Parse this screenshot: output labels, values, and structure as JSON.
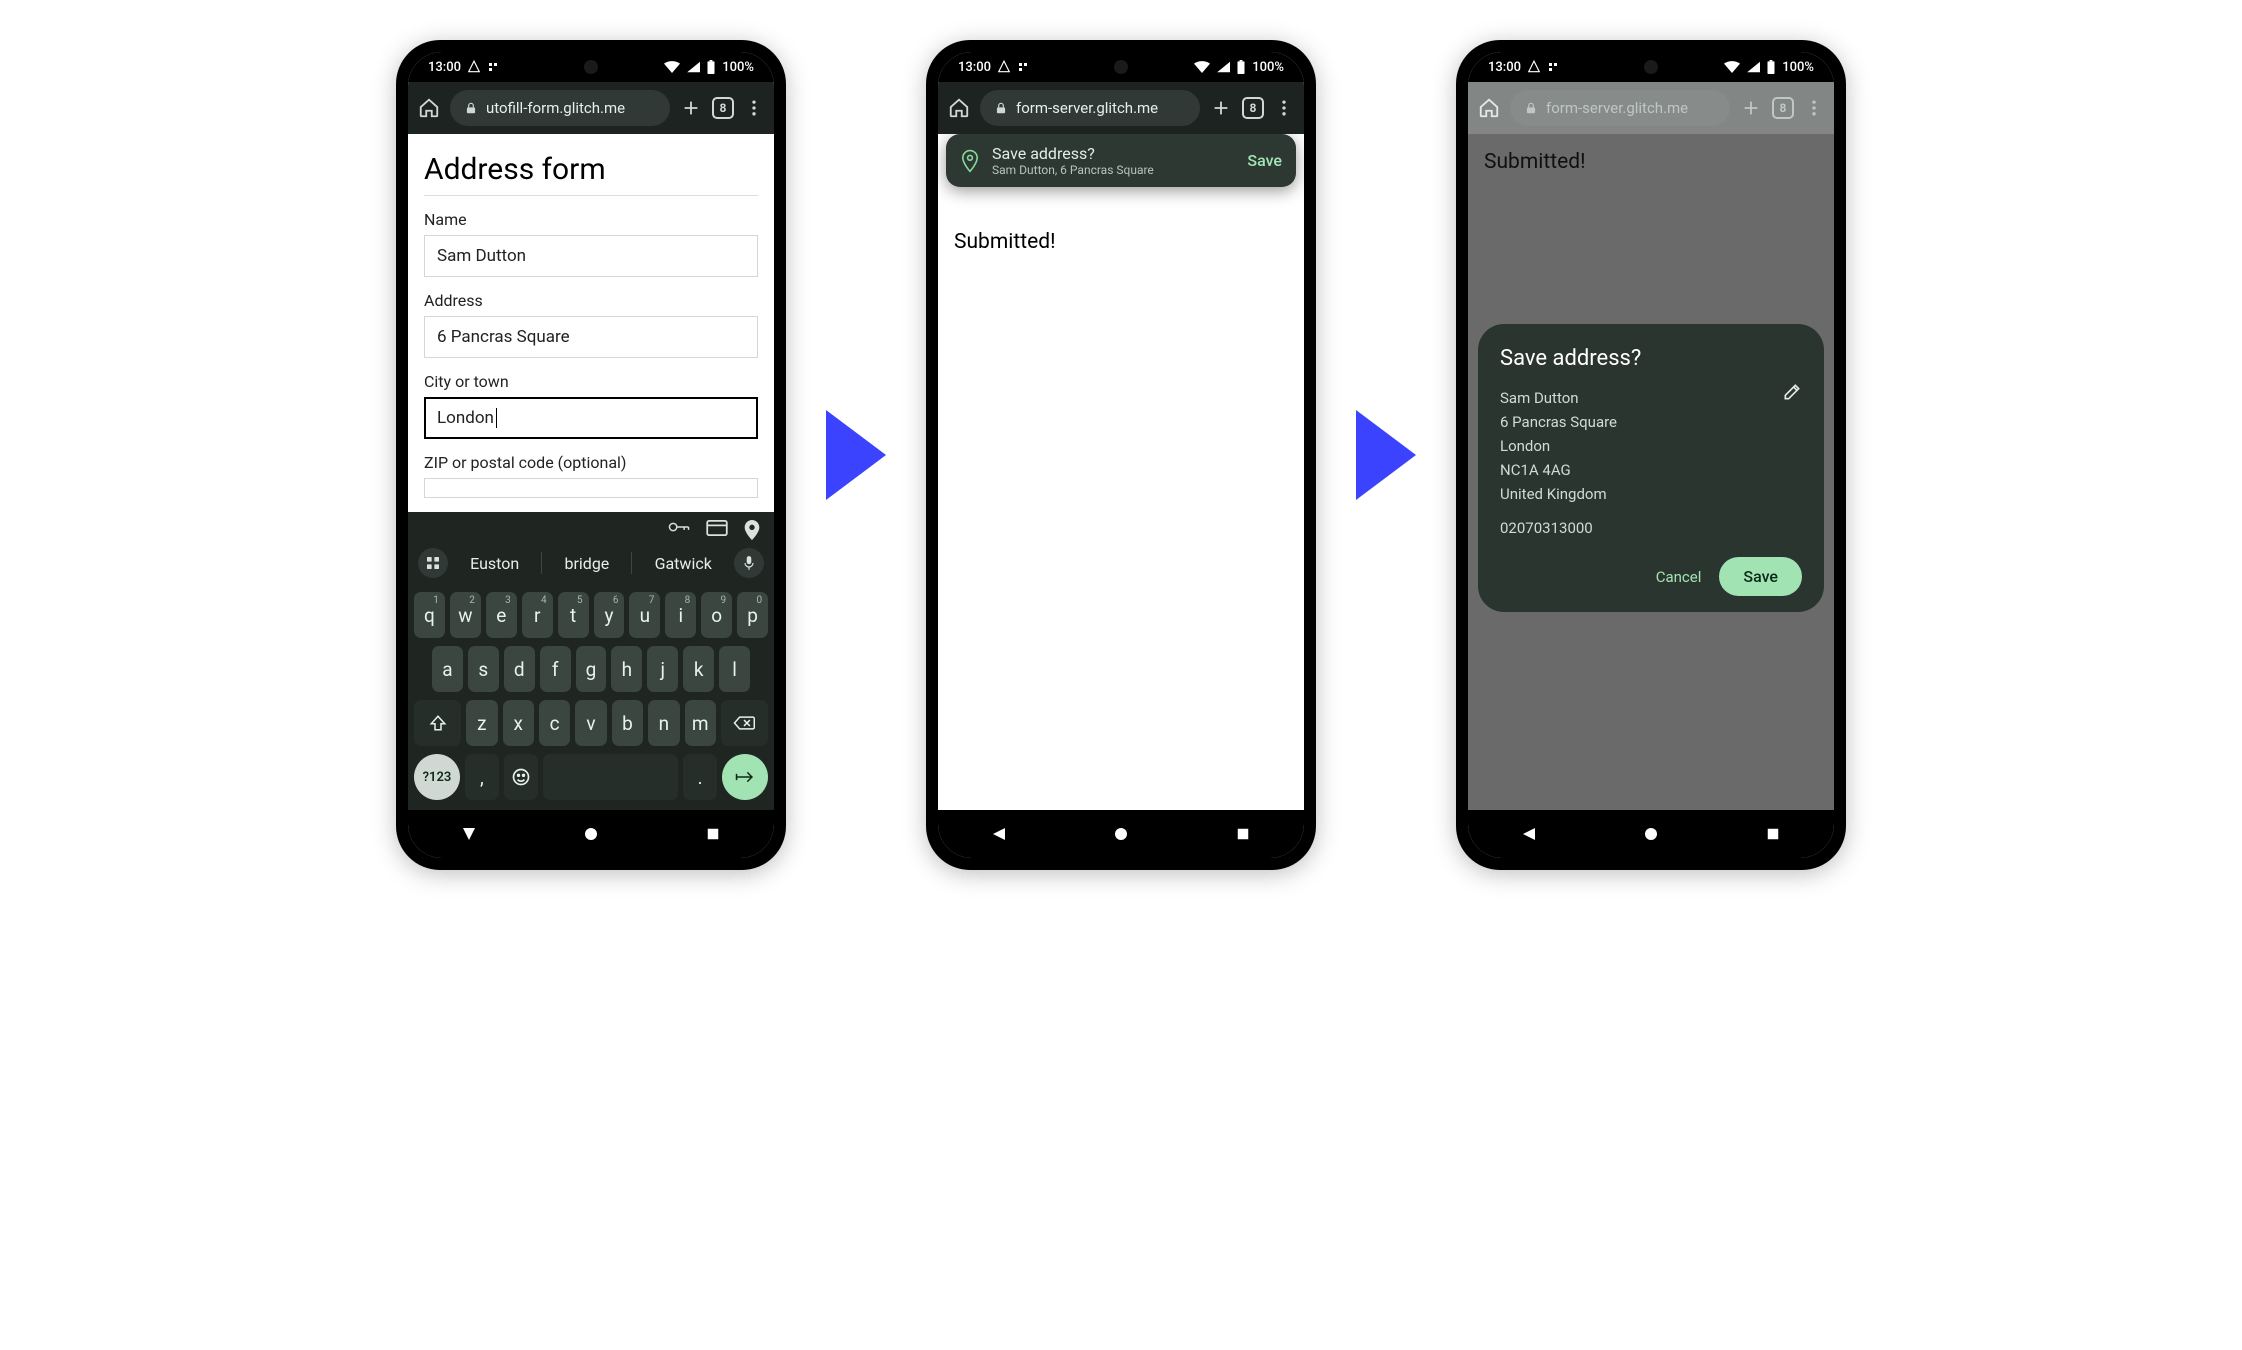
{
  "status": {
    "time": "13:00",
    "battery": "100%"
  },
  "toolbar": {
    "tab_count": "8"
  },
  "arrows": true,
  "screens": [
    {
      "url": "utofill-form.glitch.me",
      "form": {
        "title": "Address form",
        "name_label": "Name",
        "name_value": "Sam Dutton",
        "address_label": "Address",
        "address_value": "6 Pancras Square",
        "city_label": "City or town",
        "city_value": "London",
        "zip_label": "ZIP or postal code (optional)"
      },
      "keyboard": {
        "suggestions": [
          "Euston",
          "bridge",
          "Gatwick"
        ],
        "row1": [
          {
            "k": "q",
            "n": "1"
          },
          {
            "k": "w",
            "n": "2"
          },
          {
            "k": "e",
            "n": "3"
          },
          {
            "k": "r",
            "n": "4"
          },
          {
            "k": "t",
            "n": "5"
          },
          {
            "k": "y",
            "n": "6"
          },
          {
            "k": "u",
            "n": "7"
          },
          {
            "k": "i",
            "n": "8"
          },
          {
            "k": "o",
            "n": "9"
          },
          {
            "k": "p",
            "n": "0"
          }
        ],
        "row2": [
          "a",
          "s",
          "d",
          "f",
          "g",
          "h",
          "j",
          "k",
          "l"
        ],
        "row3": [
          "z",
          "x",
          "c",
          "v",
          "b",
          "n",
          "m"
        ],
        "sym": "?123"
      }
    },
    {
      "url": "form-server.glitch.me",
      "page": {
        "heading": "Submitted!"
      },
      "banner": {
        "title": "Save address?",
        "subtitle": "Sam Dutton, 6 Pancras Square",
        "action": "Save"
      }
    },
    {
      "url": "form-server.glitch.me",
      "page": {
        "heading": "Submitted!"
      },
      "dialog": {
        "title": "Save address?",
        "lines": [
          "Sam Dutton",
          "6 Pancras Square",
          "London",
          "NC1A 4AG",
          "United Kingdom"
        ],
        "phone": "02070313000",
        "cancel": "Cancel",
        "save": "Save"
      }
    }
  ]
}
